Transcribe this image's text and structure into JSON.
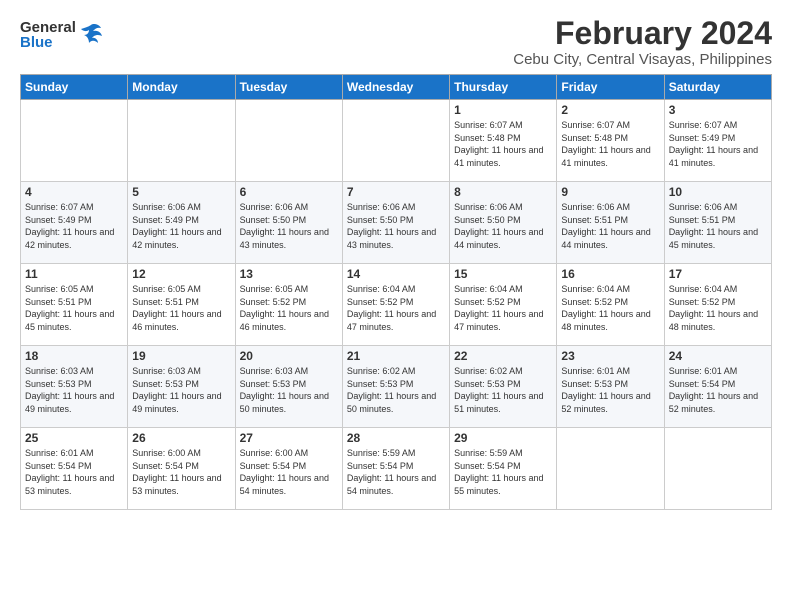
{
  "logo": {
    "general": "General",
    "blue": "Blue"
  },
  "title": "February 2024",
  "subtitle": "Cebu City, Central Visayas, Philippines",
  "headers": [
    "Sunday",
    "Monday",
    "Tuesday",
    "Wednesday",
    "Thursday",
    "Friday",
    "Saturday"
  ],
  "weeks": [
    [
      {
        "day": "",
        "info": ""
      },
      {
        "day": "",
        "info": ""
      },
      {
        "day": "",
        "info": ""
      },
      {
        "day": "",
        "info": ""
      },
      {
        "day": "1",
        "info": "Sunrise: 6:07 AM\nSunset: 5:48 PM\nDaylight: 11 hours and 41 minutes."
      },
      {
        "day": "2",
        "info": "Sunrise: 6:07 AM\nSunset: 5:48 PM\nDaylight: 11 hours and 41 minutes."
      },
      {
        "day": "3",
        "info": "Sunrise: 6:07 AM\nSunset: 5:49 PM\nDaylight: 11 hours and 41 minutes."
      }
    ],
    [
      {
        "day": "4",
        "info": "Sunrise: 6:07 AM\nSunset: 5:49 PM\nDaylight: 11 hours and 42 minutes."
      },
      {
        "day": "5",
        "info": "Sunrise: 6:06 AM\nSunset: 5:49 PM\nDaylight: 11 hours and 42 minutes."
      },
      {
        "day": "6",
        "info": "Sunrise: 6:06 AM\nSunset: 5:50 PM\nDaylight: 11 hours and 43 minutes."
      },
      {
        "day": "7",
        "info": "Sunrise: 6:06 AM\nSunset: 5:50 PM\nDaylight: 11 hours and 43 minutes."
      },
      {
        "day": "8",
        "info": "Sunrise: 6:06 AM\nSunset: 5:50 PM\nDaylight: 11 hours and 44 minutes."
      },
      {
        "day": "9",
        "info": "Sunrise: 6:06 AM\nSunset: 5:51 PM\nDaylight: 11 hours and 44 minutes."
      },
      {
        "day": "10",
        "info": "Sunrise: 6:06 AM\nSunset: 5:51 PM\nDaylight: 11 hours and 45 minutes."
      }
    ],
    [
      {
        "day": "11",
        "info": "Sunrise: 6:05 AM\nSunset: 5:51 PM\nDaylight: 11 hours and 45 minutes."
      },
      {
        "day": "12",
        "info": "Sunrise: 6:05 AM\nSunset: 5:51 PM\nDaylight: 11 hours and 46 minutes."
      },
      {
        "day": "13",
        "info": "Sunrise: 6:05 AM\nSunset: 5:52 PM\nDaylight: 11 hours and 46 minutes."
      },
      {
        "day": "14",
        "info": "Sunrise: 6:04 AM\nSunset: 5:52 PM\nDaylight: 11 hours and 47 minutes."
      },
      {
        "day": "15",
        "info": "Sunrise: 6:04 AM\nSunset: 5:52 PM\nDaylight: 11 hours and 47 minutes."
      },
      {
        "day": "16",
        "info": "Sunrise: 6:04 AM\nSunset: 5:52 PM\nDaylight: 11 hours and 48 minutes."
      },
      {
        "day": "17",
        "info": "Sunrise: 6:04 AM\nSunset: 5:52 PM\nDaylight: 11 hours and 48 minutes."
      }
    ],
    [
      {
        "day": "18",
        "info": "Sunrise: 6:03 AM\nSunset: 5:53 PM\nDaylight: 11 hours and 49 minutes."
      },
      {
        "day": "19",
        "info": "Sunrise: 6:03 AM\nSunset: 5:53 PM\nDaylight: 11 hours and 49 minutes."
      },
      {
        "day": "20",
        "info": "Sunrise: 6:03 AM\nSunset: 5:53 PM\nDaylight: 11 hours and 50 minutes."
      },
      {
        "day": "21",
        "info": "Sunrise: 6:02 AM\nSunset: 5:53 PM\nDaylight: 11 hours and 50 minutes."
      },
      {
        "day": "22",
        "info": "Sunrise: 6:02 AM\nSunset: 5:53 PM\nDaylight: 11 hours and 51 minutes."
      },
      {
        "day": "23",
        "info": "Sunrise: 6:01 AM\nSunset: 5:53 PM\nDaylight: 11 hours and 52 minutes."
      },
      {
        "day": "24",
        "info": "Sunrise: 6:01 AM\nSunset: 5:54 PM\nDaylight: 11 hours and 52 minutes."
      }
    ],
    [
      {
        "day": "25",
        "info": "Sunrise: 6:01 AM\nSunset: 5:54 PM\nDaylight: 11 hours and 53 minutes."
      },
      {
        "day": "26",
        "info": "Sunrise: 6:00 AM\nSunset: 5:54 PM\nDaylight: 11 hours and 53 minutes."
      },
      {
        "day": "27",
        "info": "Sunrise: 6:00 AM\nSunset: 5:54 PM\nDaylight: 11 hours and 54 minutes."
      },
      {
        "day": "28",
        "info": "Sunrise: 5:59 AM\nSunset: 5:54 PM\nDaylight: 11 hours and 54 minutes."
      },
      {
        "day": "29",
        "info": "Sunrise: 5:59 AM\nSunset: 5:54 PM\nDaylight: 11 hours and 55 minutes."
      },
      {
        "day": "",
        "info": ""
      },
      {
        "day": "",
        "info": ""
      }
    ]
  ]
}
